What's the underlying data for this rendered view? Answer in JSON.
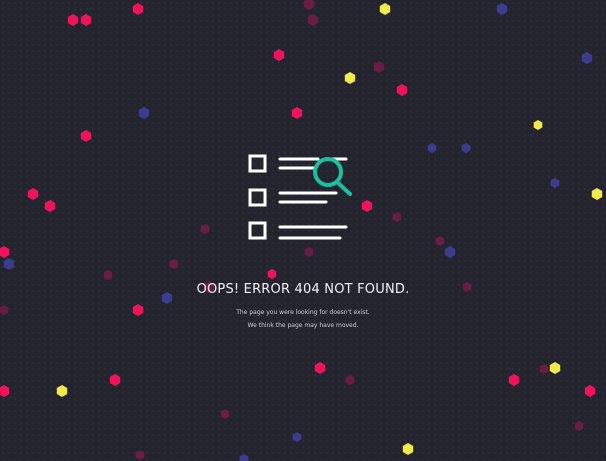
{
  "error": {
    "title": "OOPS! ERROR 404 NOT FOUND.",
    "line1": "The page you were looking for doesn't exist.",
    "line2": "We think the page may have moved."
  },
  "icon": {
    "name": "document-search-icon",
    "accent_color": "#1bbfa0",
    "line_color": "#ffffff"
  },
  "colors": {
    "background": "#24242f",
    "particle_pink": "#f0135a",
    "particle_yellow": "#f2ea4a",
    "particle_navy": "#3a3d8f",
    "particle_dim": "#6a1c44"
  }
}
